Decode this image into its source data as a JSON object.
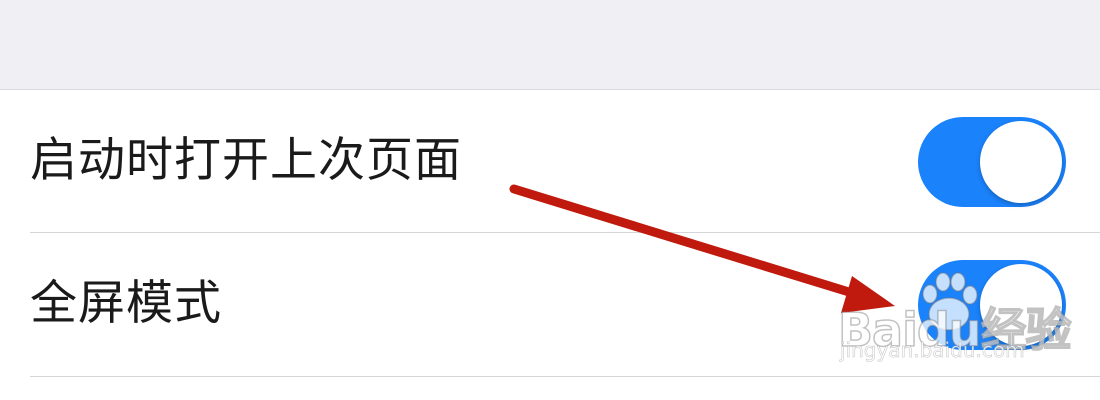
{
  "settings": {
    "items": [
      {
        "label": "启动时打开上次页面",
        "enabled": true
      },
      {
        "label": "全屏模式",
        "enabled": true
      }
    ]
  },
  "colors": {
    "toggle_on": "#1a82fb",
    "annotation_arrow": "#c0190d",
    "header_background": "#efeff4"
  },
  "watermark": {
    "logo_text": "Baidu经验",
    "url_text": "jingyan.baidu.com"
  },
  "icons": {
    "annotation": "red-arrow-icon",
    "watermark": "baidu-paw-logo"
  }
}
